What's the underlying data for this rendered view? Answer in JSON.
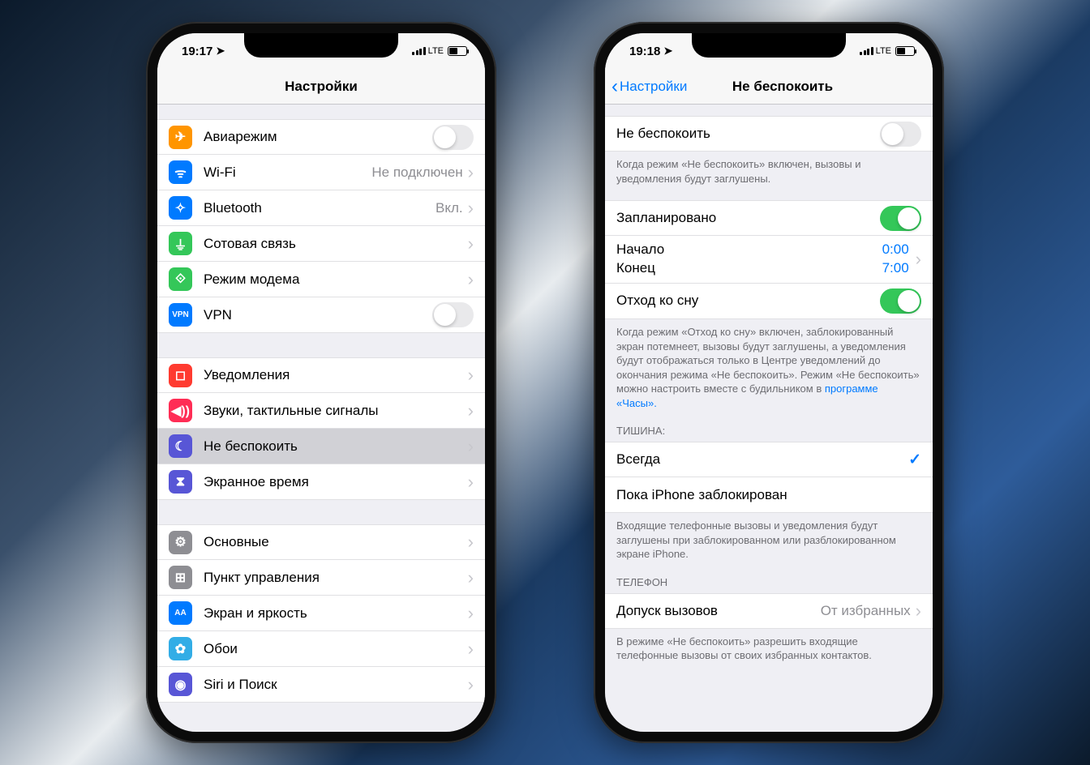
{
  "left": {
    "status": {
      "time": "19:17",
      "carrier": "LTE"
    },
    "title": "Настройки",
    "g1": [
      {
        "icon": "airplane",
        "color": "c-orange",
        "label": "Авиарежим",
        "type": "toggle",
        "on": false
      },
      {
        "icon": "wifi",
        "color": "c-blue",
        "label": "Wi-Fi",
        "detail": "Не подключен",
        "type": "link"
      },
      {
        "icon": "bluetooth",
        "color": "c-bt",
        "label": "Bluetooth",
        "detail": "Вкл.",
        "type": "link"
      },
      {
        "icon": "antenna",
        "color": "c-cell",
        "label": "Сотовая связь",
        "type": "link"
      },
      {
        "icon": "link",
        "color": "c-hot",
        "label": "Режим модема",
        "type": "link"
      },
      {
        "icon": "vpn",
        "color": "c-vpn",
        "label": "VPN",
        "type": "toggle",
        "on": false
      }
    ],
    "g2": [
      {
        "icon": "bell",
        "color": "c-red",
        "label": "Уведомления",
        "type": "link"
      },
      {
        "icon": "speaker",
        "color": "c-pink2",
        "label": "Звуки, тактильные сигналы",
        "type": "link"
      },
      {
        "icon": "moon",
        "color": "c-purple",
        "label": "Не беспокоить",
        "type": "link",
        "highlight": true
      },
      {
        "icon": "hourglass",
        "color": "c-indigo",
        "label": "Экранное время",
        "type": "link"
      }
    ],
    "g3": [
      {
        "icon": "gear",
        "color": "c-grey",
        "label": "Основные",
        "type": "link"
      },
      {
        "icon": "sliders",
        "color": "c-grey",
        "label": "Пункт управления",
        "type": "link"
      },
      {
        "icon": "aa",
        "color": "c-dblue",
        "label": "Экран и яркость",
        "type": "link"
      },
      {
        "icon": "flower",
        "color": "c-teal",
        "label": "Обои",
        "type": "link"
      },
      {
        "icon": "siri",
        "color": "c-indigo",
        "label": "Siri и Поиск",
        "type": "link"
      }
    ]
  },
  "right": {
    "status": {
      "time": "19:18",
      "carrier": "LTE"
    },
    "back": "Настройки",
    "title": "Не беспокоить",
    "dnd": {
      "label": "Не беспокоить",
      "on": false
    },
    "dnd_footer": "Когда режим «Не беспокоить» включен, вызовы и уведомления будут заглушены.",
    "scheduled": {
      "label": "Запланировано",
      "on": true
    },
    "times": {
      "from_label": "Начало",
      "from": "0:00",
      "to_label": "Конец",
      "to": "7:00"
    },
    "bedtime": {
      "label": "Отход ко сну",
      "on": true
    },
    "bedtime_footer_1": "Когда режим «Отход ко сну» включен, заблокированный экран потемнеет, вызовы будут заглушены, а уведомления будут отображаться только в Центре уведомлений до окончания режима «Не беспокоить». Режим «Не беспокоить» можно настроить вместе с будильником в ",
    "bedtime_footer_link": "программе «Часы».",
    "silence_header": "ТИШИНА:",
    "silence_always": "Всегда",
    "silence_locked": "Пока iPhone заблокирован",
    "silence_footer": "Входящие телефонные вызовы и уведомления будут заглушены при заблокированном или разблокированном экране iPhone.",
    "phone_header": "ТЕЛЕФОН",
    "allow": {
      "label": "Допуск вызовов",
      "detail": "От избранных"
    },
    "allow_footer": "В режиме «Не беспокоить» разрешить входящие телефонные вызовы от своих избранных контактов."
  }
}
